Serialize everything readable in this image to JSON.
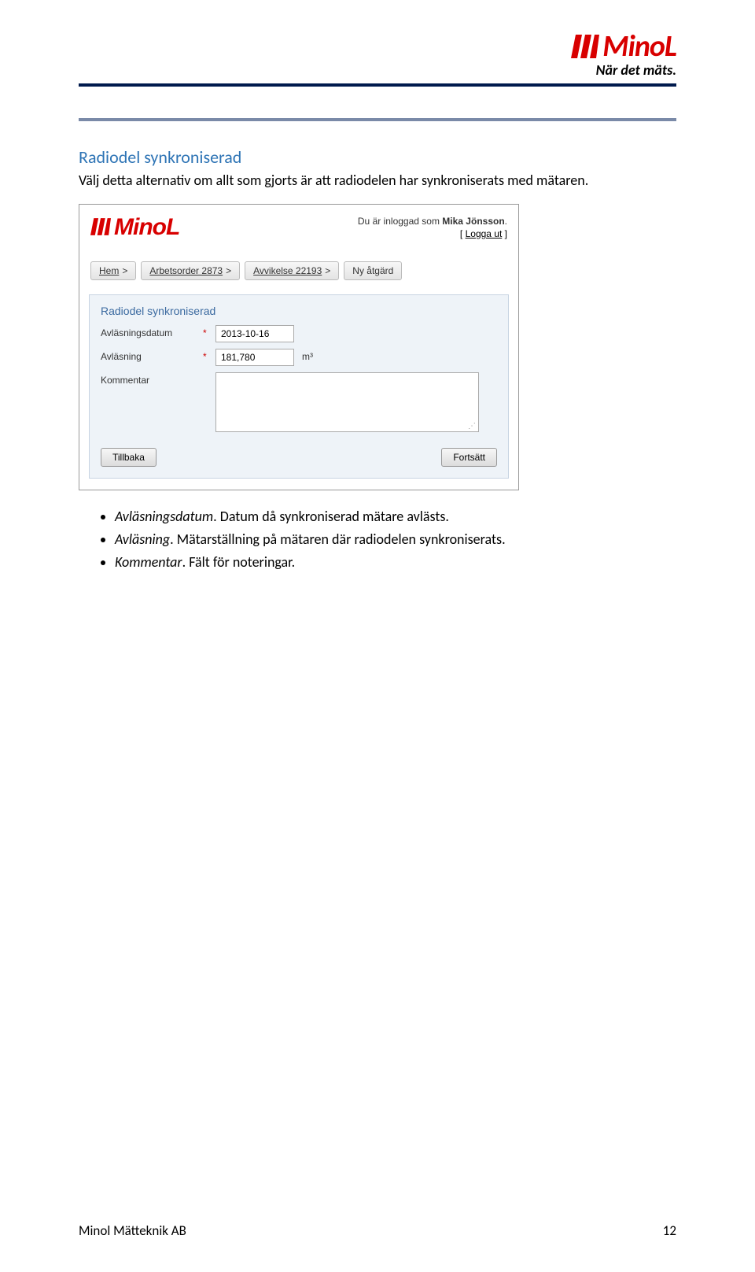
{
  "header": {
    "logo_text": "MinoL",
    "tagline": "När det mäts."
  },
  "section": {
    "title": "Radiodel synkroniserad",
    "description": "Välj detta alternativ om allt som gjorts är att radiodelen har synkroniserats med mätaren."
  },
  "app": {
    "logo_text": "MinoL",
    "user_prefix": "Du är inloggad som",
    "user_name": "Mika Jönsson",
    "user_suffix": ".",
    "logout_open": "[",
    "logout_label": "Logga ut",
    "logout_close": "]",
    "breadcrumbs": [
      {
        "label": "Hem",
        "sep": ">"
      },
      {
        "label": "Arbetsorder 2873",
        "sep": ">"
      },
      {
        "label": "Avvikelse 22193",
        "sep": ">"
      },
      {
        "label": "Ny åtgärd",
        "sep": ""
      }
    ],
    "form": {
      "title": "Radiodel synkroniserad",
      "rows": {
        "date": {
          "label": "Avläsningsdatum",
          "required": "*",
          "value": "2013-10-16"
        },
        "reading": {
          "label": "Avläsning",
          "required": "*",
          "value": "181,780",
          "unit": "m³"
        },
        "comment": {
          "label": "Kommentar",
          "required": "",
          "value": ""
        }
      },
      "buttons": {
        "back": "Tillbaka",
        "next": "Fortsätt"
      }
    }
  },
  "bullets": [
    {
      "term": "Avläsningsdatum",
      "desc": ". Datum då synkroniserad mätare avlästs."
    },
    {
      "term": "Avläsning",
      "desc": ". Mätarställning på mätaren där radiodelen synkroniserats."
    },
    {
      "term": "Kommentar",
      "desc": ". Fält för noteringar."
    }
  ],
  "footer": {
    "left": "Minol Mätteknik AB",
    "right": "12"
  }
}
